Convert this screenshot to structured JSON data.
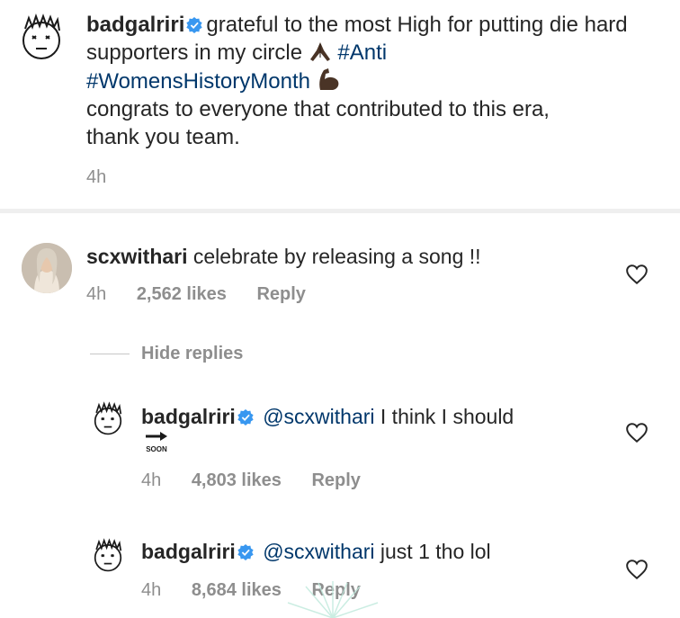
{
  "post": {
    "username": "badgalriri",
    "caption_text": "grateful to the most High for putting die hard supporters in my circle",
    "hashtag_1": "#Anti",
    "hashtag_2": "#WomensHistoryMonth",
    "caption_line2": "congrats to everyone that contributed to this era,",
    "caption_line3": "thank you team.",
    "time": "4h"
  },
  "comments": [
    {
      "username": "scxwithari",
      "text": "celebrate by releasing a song !!",
      "time": "4h",
      "likes": "2,562 likes",
      "reply": "Reply"
    }
  ],
  "hide_replies": "Hide replies",
  "replies": [
    {
      "username": "badgalriri",
      "mention": "@scxwithari",
      "text": "I think I should",
      "soon_label": "SOON",
      "time": "4h",
      "likes": "4,803 likes",
      "reply": "Reply"
    },
    {
      "username": "badgalriri",
      "mention": "@scxwithari",
      "text": "just 1 tho lol",
      "time": "4h",
      "likes": "8,684 likes",
      "reply": "Reply"
    }
  ],
  "colors": {
    "verified": "#3897f0",
    "hashtag": "#00376b",
    "meta": "#8e8e8e"
  }
}
